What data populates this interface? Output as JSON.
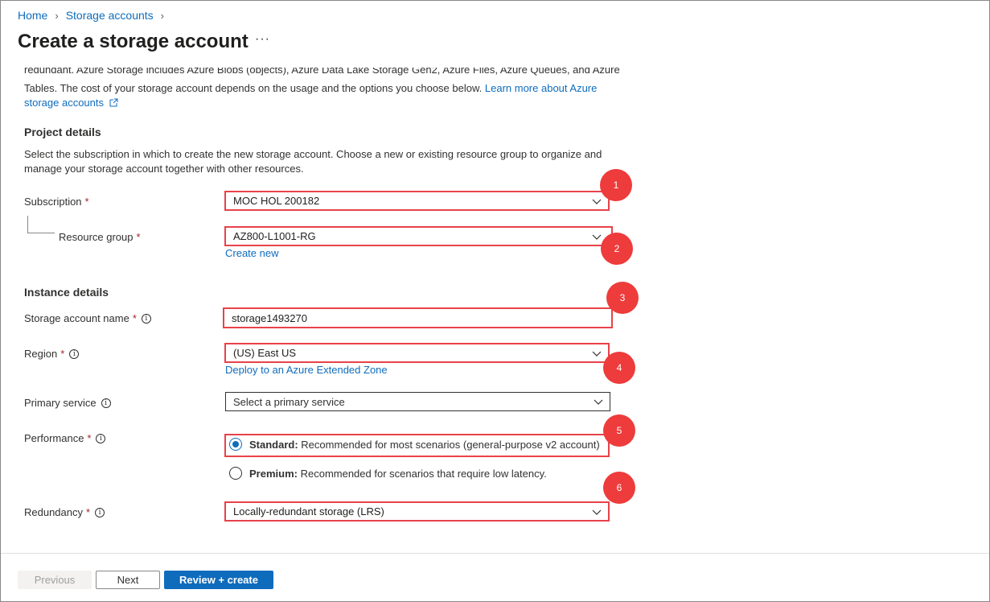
{
  "breadcrumb": {
    "home": "Home",
    "storage_accounts": "Storage accounts"
  },
  "page": {
    "title": "Create a storage account",
    "more": "···"
  },
  "intro": {
    "line1": "redundant. Azure Storage includes Azure Blobs (objects), Azure Data Lake Storage Gen2, Azure Files, Azure Queues, and Azure",
    "line2": "Tables. The cost of your storage account depends on the usage and the options you choose below.",
    "link_part1": "Learn more about Azure",
    "link_part2": "storage accounts"
  },
  "project_details": {
    "heading": "Project details",
    "description": "Select the subscription in which to create the new storage account. Choose a new or existing resource group to organize and manage your storage account together with other resources.",
    "subscription_label": "Subscription",
    "subscription_value": "MOC HOL 200182",
    "resource_group_label": "Resource group",
    "resource_group_value": "AZ800-L1001-RG",
    "create_new": "Create new"
  },
  "instance_details": {
    "heading": "Instance details",
    "name_label": "Storage account name",
    "name_value": "storage1493270",
    "region_label": "Region",
    "region_value": "(US) East US",
    "extended_zone_link": "Deploy to an Azure Extended Zone",
    "primary_service_label": "Primary service",
    "primary_service_placeholder": "Select a primary service",
    "performance_label": "Performance",
    "standard_title": "Standard:",
    "standard_desc": "Recommended for most scenarios (general-purpose v2 account)",
    "premium_title": "Premium:",
    "premium_desc": "Recommended for scenarios that require low latency.",
    "redundancy_label": "Redundancy",
    "redundancy_value": "Locally-redundant storage (LRS)"
  },
  "required_marker": "*",
  "info_glyph": "i",
  "callouts": [
    "1",
    "2",
    "3",
    "4",
    "5",
    "6"
  ],
  "footer": {
    "previous": "Previous",
    "next": "Next",
    "review_create": "Review + create"
  },
  "colors": {
    "accent": "#0f6cbd",
    "highlight": "#e8424a",
    "badge": "#ee3b3b"
  }
}
